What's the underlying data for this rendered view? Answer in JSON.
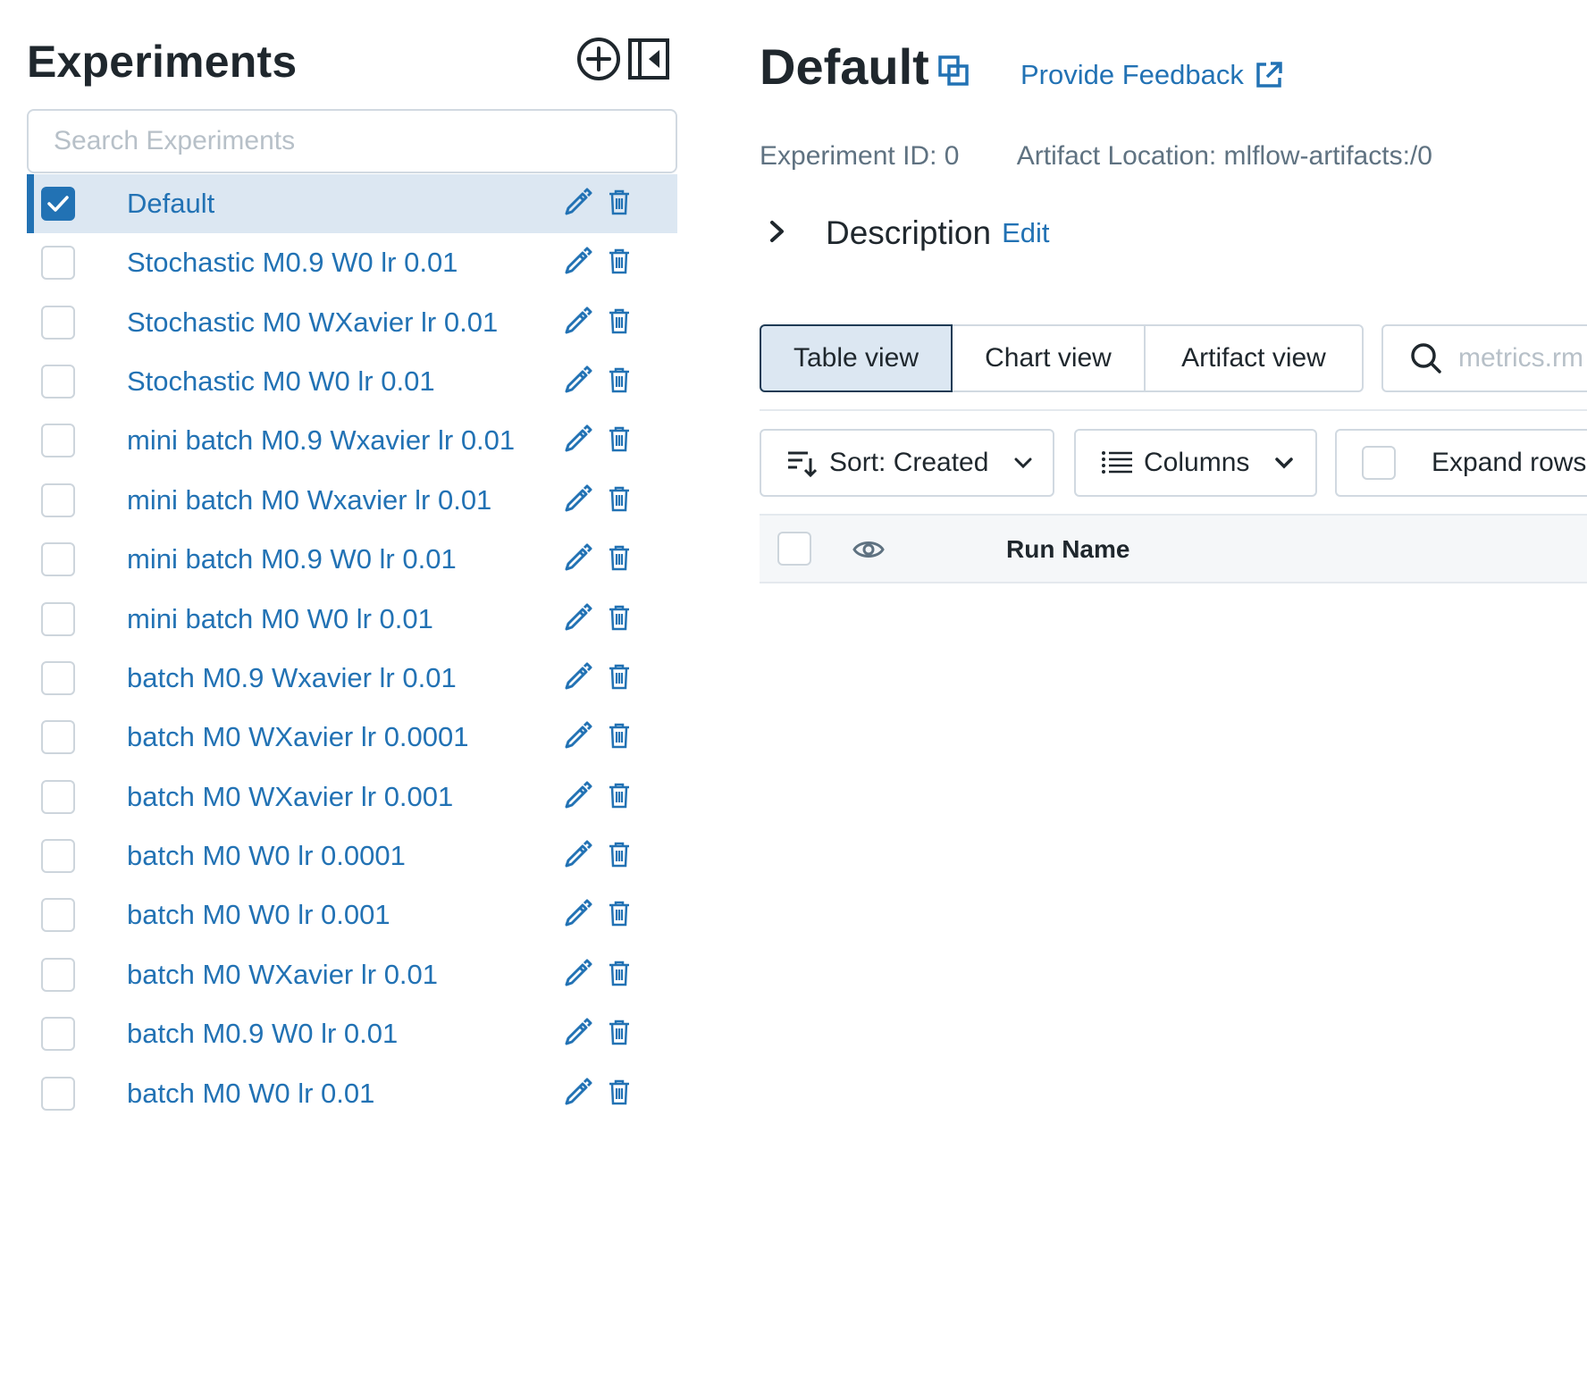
{
  "sidebar": {
    "title": "Experiments",
    "search_placeholder": "Search Experiments",
    "experiments": [
      {
        "name": "Default",
        "selected": true
      },
      {
        "name": "Stochastic M0.9 W0 lr 0.01",
        "selected": false
      },
      {
        "name": "Stochastic M0 WXavier lr 0.01",
        "selected": false
      },
      {
        "name": "Stochastic M0 W0 lr 0.01",
        "selected": false
      },
      {
        "name": "mini batch M0.9 Wxavier lr 0.01",
        "selected": false
      },
      {
        "name": "mini batch M0 Wxavier lr 0.01",
        "selected": false
      },
      {
        "name": "mini batch M0.9 W0 lr 0.01",
        "selected": false
      },
      {
        "name": "mini batch M0 W0 lr 0.01",
        "selected": false
      },
      {
        "name": "batch M0.9 Wxavier lr 0.01",
        "selected": false
      },
      {
        "name": "batch M0 WXavier lr 0.0001",
        "selected": false
      },
      {
        "name": "batch M0 WXavier lr 0.001",
        "selected": false
      },
      {
        "name": "batch M0 W0 lr 0.0001",
        "selected": false
      },
      {
        "name": "batch M0 W0 lr 0.001",
        "selected": false
      },
      {
        "name": "batch M0 WXavier lr 0.01",
        "selected": false
      },
      {
        "name": "batch M0.9 W0 lr 0.01",
        "selected": false
      },
      {
        "name": "batch M0 W0 lr 0.01",
        "selected": false
      }
    ]
  },
  "main": {
    "title": "Default",
    "feedback_label": "Provide Feedback",
    "experiment_id": "Experiment ID: 0",
    "artifact_location": "Artifact Location: mlflow-artifacts:/0",
    "description_label": "Description",
    "description_edit": "Edit",
    "tabs": [
      {
        "label": "Table view",
        "active": true
      },
      {
        "label": "Chart view",
        "active": false
      },
      {
        "label": "Artifact view",
        "active": false
      }
    ],
    "metrics_search_placeholder": "metrics.rm",
    "sort_label": "Sort: Created",
    "columns_label": "Columns",
    "expand_rows_label": "Expand rows",
    "table_header": {
      "run_name": "Run Name"
    }
  },
  "colors": {
    "accent": "#2272b4",
    "selected_bg": "#dce7f2",
    "text": "#1f272d",
    "muted": "#5f7281",
    "border": "#d1d9e1"
  }
}
